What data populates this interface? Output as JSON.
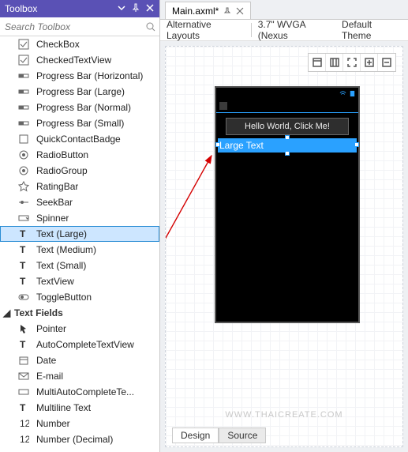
{
  "toolbox": {
    "title": "Toolbox",
    "search_placeholder": "Search Toolbox",
    "items": [
      "CheckBox",
      "CheckedTextView",
      "Progress Bar (Horizontal)",
      "Progress Bar (Large)",
      "Progress Bar (Normal)",
      "Progress Bar (Small)",
      "QuickContactBadge",
      "RadioButton",
      "RadioGroup",
      "RatingBar",
      "SeekBar",
      "Spinner",
      "Text (Large)",
      "Text (Medium)",
      "Text (Small)",
      "TextView",
      "ToggleButton"
    ],
    "selected_index": 12,
    "group_label": "Text Fields",
    "text_fields": [
      "Pointer",
      "AutoCompleteTextView",
      "Date",
      "E-mail",
      "MultiAutoCompleteTe...",
      "Multiline Text",
      "Number",
      "Number (Decimal)"
    ]
  },
  "designer": {
    "tab_label": "Main.axml*",
    "alt_layouts": "Alternative Layouts",
    "device": "3.7\" WVGA (Nexus",
    "theme": "Default Theme",
    "hello_text": "Hello World, Click Me!",
    "selected_text": "Large Text",
    "bottom_tabs": {
      "design": "Design",
      "source": "Source"
    }
  },
  "watermark": "WWW.THAICREATE.COM"
}
